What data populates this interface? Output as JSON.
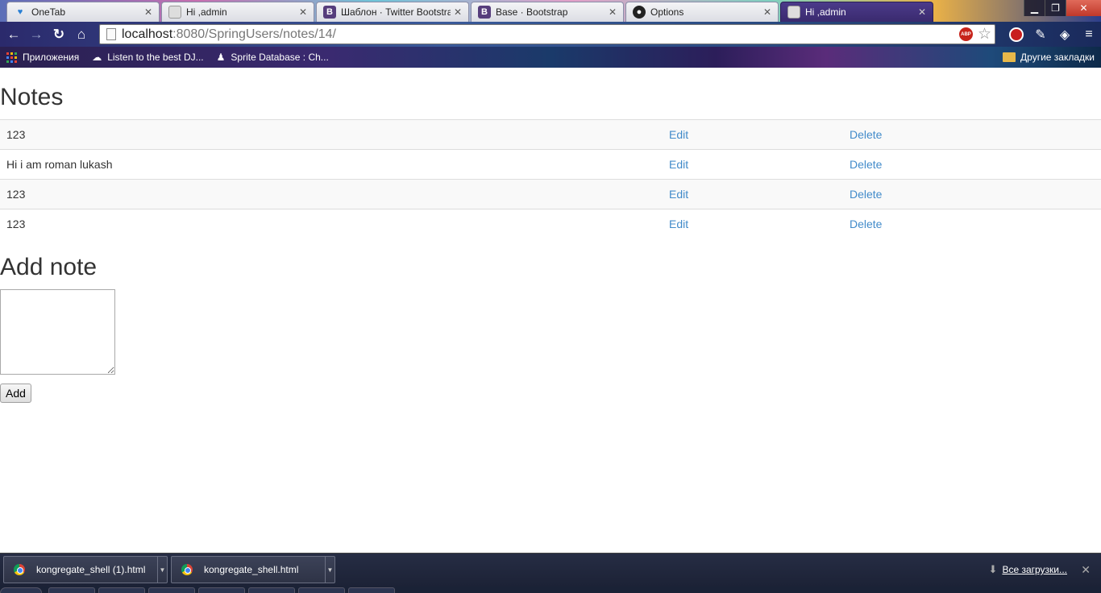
{
  "browser": {
    "tabs": [
      {
        "title": "OneTab",
        "icon": "onetab-icon",
        "active": false
      },
      {
        "title": "Hi ,admin",
        "icon": "page-image-icon",
        "active": false
      },
      {
        "title": "Шаблон · Twitter Bootstra",
        "icon": "bootstrap-icon",
        "active": false
      },
      {
        "title": "Base · Bootstrap",
        "icon": "bootstrap-icon",
        "active": false
      },
      {
        "title": "Options",
        "icon": "github-icon",
        "active": false
      },
      {
        "title": "Hi ,admin",
        "icon": "page-image-icon",
        "active": true
      }
    ],
    "address": {
      "host": "localhost",
      "path": ":8080/SpringUsers/notes/14/"
    },
    "bookmarks": {
      "apps": "Приложения",
      "item1": "Listen to the best DJ...",
      "item2": "Sprite Database : Ch...",
      "other": "Другие закладки"
    },
    "extension_badge": "ABP"
  },
  "page": {
    "notes_title": "Notes",
    "notes": [
      {
        "text": "123",
        "edit": "Edit",
        "delete": "Delete"
      },
      {
        "text": "Hi i am roman lukash",
        "edit": "Edit",
        "delete": "Delete"
      },
      {
        "text": "123",
        "edit": "Edit",
        "delete": "Delete"
      },
      {
        "text": "123",
        "edit": "Edit",
        "delete": "Delete"
      }
    ],
    "add_title": "Add note",
    "textarea_value": "",
    "add_button": "Add"
  },
  "downloads": {
    "items": [
      {
        "name": "kongregate_shell (1).html"
      },
      {
        "name": "kongregate_shell.html"
      }
    ],
    "show_all": "Все загрузки..."
  },
  "colors": {
    "link": "#428bca",
    "text": "#333333",
    "stripe": "#f9f9f9",
    "border": "#dddddd"
  }
}
